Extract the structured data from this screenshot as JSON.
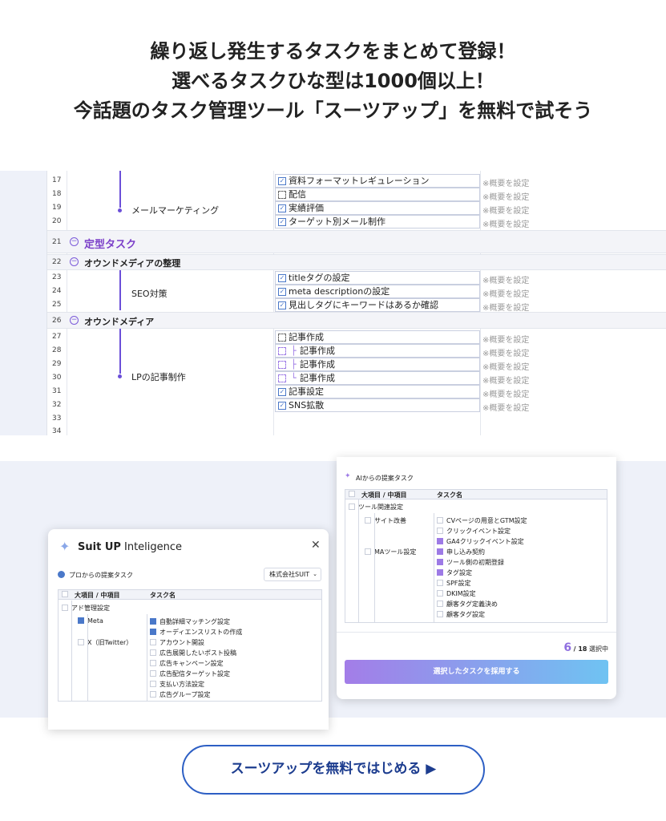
{
  "headline": [
    "繰り返し発生するタスクをまとめて登録！",
    "選べるタスクひな型は1000個以上！",
    "今話題のタスク管理ツール「スーツアップ」を無料で試そう"
  ],
  "sheet": {
    "memo": "※概要を設定",
    "rows1": [
      {
        "n": "17",
        "task": "資料フォーマットレギュレーション",
        "checked": true
      },
      {
        "n": "18",
        "task": "配信",
        "checked": false
      },
      {
        "n": "19",
        "task": "実績評価",
        "checked": true
      },
      {
        "n": "20",
        "task": "ターゲット別メール制作",
        "checked": true
      }
    ],
    "group_mail": "メールマーケティング",
    "row21": {
      "n": "21",
      "label": "定型タスク"
    },
    "row22": {
      "n": "22",
      "label": "オウンドメディアの整理"
    },
    "rows2": [
      {
        "n": "23",
        "task": "titleタグの設定",
        "checked": true
      },
      {
        "n": "24",
        "task": "meta descriptionの設定",
        "checked": true
      },
      {
        "n": "25",
        "task": "見出しタグにキーワードはあるか確認",
        "checked": true
      }
    ],
    "group_seo": "SEO対策",
    "row26": {
      "n": "26",
      "label": "オウンドメディア"
    },
    "rows3": [
      {
        "n": "27",
        "task": "記事作成",
        "checked": false,
        "sub": false
      },
      {
        "n": "28",
        "task": "記事作成",
        "checked": false,
        "sub": true
      },
      {
        "n": "29",
        "task": "記事作成",
        "checked": false,
        "sub": true
      },
      {
        "n": "30",
        "task": "記事作成",
        "checked": false,
        "sub": true
      },
      {
        "n": "31",
        "task": "記事設定",
        "checked": true,
        "sub": false
      },
      {
        "n": "32",
        "task": "SNS拡散",
        "checked": true,
        "sub": false
      }
    ],
    "group_lp": "LPの記事制作",
    "row33": "33",
    "row34": "34"
  },
  "left_panel": {
    "brand": "Suit UP",
    "brand_sub": "Inteligence",
    "close": "✕",
    "section": "プロからの提案タスク",
    "company": "株式会社SUIT",
    "col1": "大項目 / 中項目",
    "col2": "タスク名",
    "cat": "アド管理設定",
    "sub1": "Meta",
    "sub2": "X（旧Twitter）",
    "tasks": [
      "自動詳細マッチング設定",
      "オーディエンスリストの作成",
      "アカウント開設",
      "広告展開したいポスト投稿",
      "広告キャンペーン設定",
      "広告配信ターゲット設定",
      "支払い方法設定",
      "広告グループ設定"
    ]
  },
  "right_panel": {
    "section": "AIからの提案タスク",
    "col1": "大項目 / 中項目",
    "col2": "タスク名",
    "cat": "ツール関連設定",
    "sub1": "サイト改善",
    "sub2": "MAツール設定",
    "tasks": [
      "CVページの用意とGTM設定",
      "クリックイベント設定",
      "GA4クリックイベント設定",
      "申し込み契約",
      "ツール側の初期登録",
      "タグ設定",
      "SPF設定",
      "DKIM設定",
      "顧客タグ定義決め",
      "顧客タグ設定"
    ],
    "count": "6",
    "total": "/ 18",
    "selected": "選択中",
    "adopt": "選択したタスクを採用する"
  },
  "cta": "スーツアップを無料ではじめる ▶"
}
